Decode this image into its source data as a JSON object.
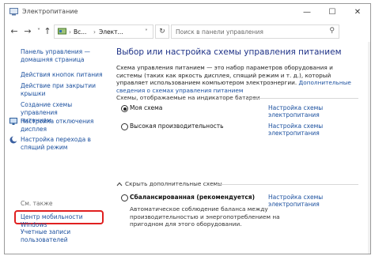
{
  "window": {
    "title": "Электропитание",
    "controls": {
      "minimize": "—",
      "maximize": "☐",
      "close": "✕"
    }
  },
  "address_bar": {
    "back_icon": "←",
    "forward_icon": "→",
    "recent_icon": "˅",
    "up_icon": "↑",
    "breadcrumb": [
      "Вс...",
      "Элект..."
    ],
    "dropdown_icon": "˅",
    "refresh_icon": "↻",
    "search_placeholder": "Поиск в панели управления",
    "search_icon": "⚲"
  },
  "sidebar": {
    "home_link": [
      "Панель управления —",
      "домашняя страница"
    ],
    "links": [
      {
        "lines": [
          "Действия кнопок питания"
        ],
        "icon": null
      },
      {
        "lines": [
          "Действие при закрытии",
          "крышки"
        ],
        "icon": null
      },
      {
        "lines": [
          "Создание схемы управления",
          "питанием"
        ],
        "icon": null
      },
      {
        "lines": [
          "Настройка отключения",
          "дисплея"
        ],
        "icon": "monitor-icon"
      },
      {
        "lines": [
          "Настройка перехода в",
          "спящий режим"
        ],
        "icon": "moon-icon"
      }
    ],
    "see_also_label": "См. также",
    "see_also_links": [
      {
        "lines": [
          "Центр мобильности Windows"
        ],
        "highlighted": true
      },
      {
        "lines": [
          "Учетные записи",
          "пользователей"
        ],
        "highlighted": false
      }
    ]
  },
  "main": {
    "heading": "Выбор или настройка схемы управления питанием",
    "description": "Схема управления питанием — это набор параметров оборудования и системы (таких как яркость дисплея, спящий режим и т. д.), который управляет использованием компьютером электроэнергии.",
    "description_link": "Дополнительные сведения о схемах управления питанием",
    "battery_section_label": "Схемы, отображаемые на индикаторе батареи",
    "plans": [
      {
        "name": "Моя схема",
        "selected": true,
        "bold": false,
        "link": "Настройка схемы электропитания"
      },
      {
        "name": "Высокая производительность",
        "selected": false,
        "bold": false,
        "link": "Настройка схемы электропитания"
      }
    ],
    "hidden_toggle": "Скрыть дополнительные схемы",
    "hidden_plans": [
      {
        "name": "Сбалансированная (рекомендуется)",
        "selected": false,
        "bold": true,
        "link": "Настройка схемы электропитания"
      }
    ],
    "hidden_plan_description": "Автоматическое соблюдение баланса между производительностью и энергопотреблением на пригодном для этого оборудовании."
  }
}
